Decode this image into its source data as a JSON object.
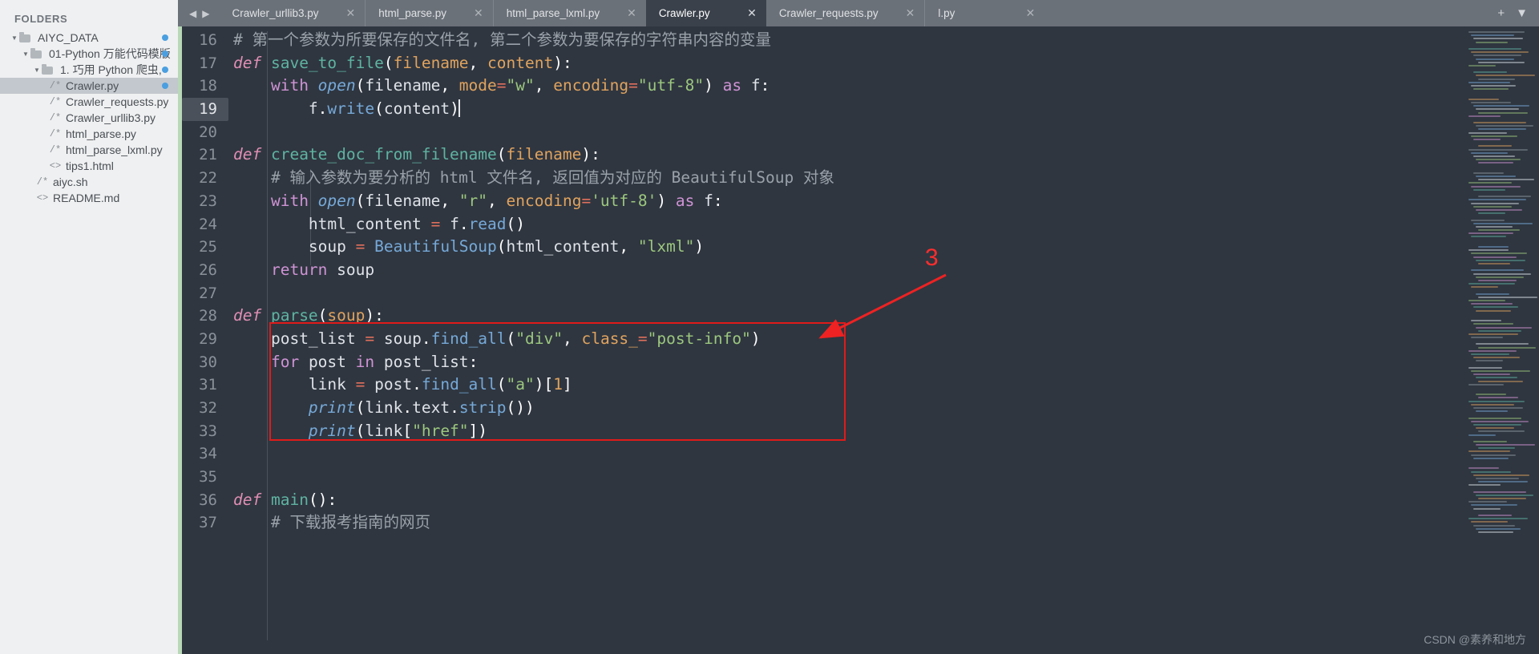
{
  "sidebar": {
    "title": "FOLDERS",
    "items": [
      {
        "label": "AIYC_DATA",
        "kind": "folder",
        "depth": 0,
        "expanded": true,
        "dot": true,
        "selected": false,
        "icon": "folder-icon"
      },
      {
        "label": "01-Python 万能代码模版",
        "kind": "folder",
        "depth": 1,
        "expanded": true,
        "dot": true,
        "selected": false,
        "icon": "folder-icon"
      },
      {
        "label": "1. 巧用 Python 爬虫,",
        "kind": "folder",
        "depth": 2,
        "expanded": true,
        "dot": true,
        "selected": false,
        "icon": "folder-icon"
      },
      {
        "label": "Crawler.py",
        "kind": "py",
        "depth": 3,
        "expanded": false,
        "dot": true,
        "selected": true,
        "icon": "python-file-icon"
      },
      {
        "label": "Crawler_requests.py",
        "kind": "py",
        "depth": 3,
        "expanded": false,
        "dot": false,
        "selected": false,
        "icon": "python-file-icon"
      },
      {
        "label": "Crawler_urllib3.py",
        "kind": "py",
        "depth": 3,
        "expanded": false,
        "dot": false,
        "selected": false,
        "icon": "python-file-icon"
      },
      {
        "label": "html_parse.py",
        "kind": "py",
        "depth": 3,
        "expanded": false,
        "dot": false,
        "selected": false,
        "icon": "python-file-icon"
      },
      {
        "label": "html_parse_lxml.py",
        "kind": "py",
        "depth": 3,
        "expanded": false,
        "dot": false,
        "selected": false,
        "icon": "python-file-icon"
      },
      {
        "label": "tips1.html",
        "kind": "html",
        "depth": 3,
        "expanded": false,
        "dot": false,
        "selected": false,
        "icon": "html-file-icon"
      },
      {
        "label": "aiyc.sh",
        "kind": "py",
        "depth": 2,
        "expanded": false,
        "dot": false,
        "selected": false,
        "icon": "shell-file-icon"
      },
      {
        "label": "README.md",
        "kind": "html",
        "depth": 2,
        "expanded": false,
        "dot": false,
        "selected": false,
        "icon": "markdown-file-icon"
      }
    ],
    "py_glyph": "/*",
    "html_glyph": "<>",
    "arrow_glyph": "▼"
  },
  "tabbar": {
    "nav_back": "◀",
    "nav_forward": "▶",
    "close_glyph": "✕",
    "new_tab_glyph": "+",
    "dropdown_glyph": "▼",
    "tabs": [
      {
        "label": "Crawler_urllib3.py",
        "active": false
      },
      {
        "label": "html_parse.py",
        "active": false
      },
      {
        "label": "html_parse_lxml.py",
        "active": false
      },
      {
        "label": "Crawler.py",
        "active": true
      },
      {
        "label": "Crawler_requests.py",
        "active": false
      },
      {
        "label": "l.py",
        "active": false
      }
    ]
  },
  "editor": {
    "current_line": 19,
    "first_line": 16,
    "lines": [
      {
        "n": 16,
        "tokens": [
          {
            "t": "# 第一个参数为所要保存的文件名, 第二个参数为要保存的字符串内容的变量",
            "c": "cmt"
          }
        ]
      },
      {
        "n": 17,
        "tokens": [
          {
            "t": "def ",
            "c": "kw"
          },
          {
            "t": "save_to_file",
            "c": "fn"
          },
          {
            "t": "(",
            "c": "punct"
          },
          {
            "t": "filename",
            "c": "param"
          },
          {
            "t": ", ",
            "c": "punct"
          },
          {
            "t": "content",
            "c": "param"
          },
          {
            "t": ")",
            "c": "punct"
          },
          {
            "t": ":",
            "c": "punct"
          }
        ]
      },
      {
        "n": 18,
        "tokens": [
          {
            "t": "    ",
            "c": "plain"
          },
          {
            "t": "with ",
            "c": "kw2"
          },
          {
            "t": "open",
            "c": "blt"
          },
          {
            "t": "(",
            "c": "punct"
          },
          {
            "t": "filename",
            "c": "plain"
          },
          {
            "t": ", ",
            "c": "punct"
          },
          {
            "t": "mode",
            "c": "param"
          },
          {
            "t": "=",
            "c": "op"
          },
          {
            "t": "\"w\"",
            "c": "str"
          },
          {
            "t": ", ",
            "c": "punct"
          },
          {
            "t": "encoding",
            "c": "param"
          },
          {
            "t": "=",
            "c": "op"
          },
          {
            "t": "\"utf-8\"",
            "c": "str"
          },
          {
            "t": ")",
            "c": "punct"
          },
          {
            "t": " as ",
            "c": "kw2"
          },
          {
            "t": "f",
            "c": "plain"
          },
          {
            "t": ":",
            "c": "punct"
          }
        ]
      },
      {
        "n": 19,
        "tokens": [
          {
            "t": "        ",
            "c": "plain"
          },
          {
            "t": "f",
            "c": "plain"
          },
          {
            "t": ".",
            "c": "punct"
          },
          {
            "t": "write",
            "c": "fn2"
          },
          {
            "t": "(",
            "c": "punct"
          },
          {
            "t": "content",
            "c": "plain"
          },
          {
            "t": ")",
            "c": "punct"
          }
        ]
      },
      {
        "n": 20,
        "tokens": []
      },
      {
        "n": 21,
        "tokens": [
          {
            "t": "def ",
            "c": "kw"
          },
          {
            "t": "create_doc_from_filename",
            "c": "fn"
          },
          {
            "t": "(",
            "c": "punct"
          },
          {
            "t": "filename",
            "c": "param"
          },
          {
            "t": ")",
            "c": "punct"
          },
          {
            "t": ":",
            "c": "punct"
          }
        ]
      },
      {
        "n": 22,
        "tokens": [
          {
            "t": "    ",
            "c": "plain"
          },
          {
            "t": "# 输入参数为要分析的 html 文件名, 返回值为对应的 BeautifulSoup 对象",
            "c": "cmt"
          }
        ]
      },
      {
        "n": 23,
        "tokens": [
          {
            "t": "    ",
            "c": "plain"
          },
          {
            "t": "with ",
            "c": "kw2"
          },
          {
            "t": "open",
            "c": "blt"
          },
          {
            "t": "(",
            "c": "punct"
          },
          {
            "t": "filename",
            "c": "plain"
          },
          {
            "t": ", ",
            "c": "punct"
          },
          {
            "t": "\"r\"",
            "c": "str"
          },
          {
            "t": ", ",
            "c": "punct"
          },
          {
            "t": "encoding",
            "c": "param"
          },
          {
            "t": "=",
            "c": "op"
          },
          {
            "t": "'utf-8'",
            "c": "str"
          },
          {
            "t": ")",
            "c": "punct"
          },
          {
            "t": " as ",
            "c": "kw2"
          },
          {
            "t": "f",
            "c": "plain"
          },
          {
            "t": ":",
            "c": "punct"
          }
        ]
      },
      {
        "n": 24,
        "tokens": [
          {
            "t": "        ",
            "c": "plain"
          },
          {
            "t": "html_content",
            "c": "plain"
          },
          {
            "t": " ",
            "c": "plain"
          },
          {
            "t": "=",
            "c": "op"
          },
          {
            "t": " ",
            "c": "plain"
          },
          {
            "t": "f",
            "c": "plain"
          },
          {
            "t": ".",
            "c": "punct"
          },
          {
            "t": "read",
            "c": "fn2"
          },
          {
            "t": "()",
            "c": "punct"
          }
        ]
      },
      {
        "n": 25,
        "tokens": [
          {
            "t": "        ",
            "c": "plain"
          },
          {
            "t": "soup",
            "c": "plain"
          },
          {
            "t": " ",
            "c": "plain"
          },
          {
            "t": "=",
            "c": "op"
          },
          {
            "t": " ",
            "c": "plain"
          },
          {
            "t": "BeautifulSoup",
            "c": "fn2"
          },
          {
            "t": "(",
            "c": "punct"
          },
          {
            "t": "html_content",
            "c": "plain"
          },
          {
            "t": ", ",
            "c": "punct"
          },
          {
            "t": "\"lxml\"",
            "c": "str"
          },
          {
            "t": ")",
            "c": "punct"
          }
        ]
      },
      {
        "n": 26,
        "tokens": [
          {
            "t": "    ",
            "c": "plain"
          },
          {
            "t": "return ",
            "c": "kw2"
          },
          {
            "t": "soup",
            "c": "plain"
          }
        ]
      },
      {
        "n": 27,
        "tokens": []
      },
      {
        "n": 28,
        "tokens": [
          {
            "t": "def ",
            "c": "kw"
          },
          {
            "t": "parse",
            "c": "fn"
          },
          {
            "t": "(",
            "c": "punct"
          },
          {
            "t": "soup",
            "c": "param"
          },
          {
            "t": ")",
            "c": "punct"
          },
          {
            "t": ":",
            "c": "punct"
          }
        ]
      },
      {
        "n": 29,
        "tokens": [
          {
            "t": "    ",
            "c": "plain"
          },
          {
            "t": "post_list",
            "c": "plain"
          },
          {
            "t": " ",
            "c": "plain"
          },
          {
            "t": "=",
            "c": "op"
          },
          {
            "t": " ",
            "c": "plain"
          },
          {
            "t": "soup",
            "c": "plain"
          },
          {
            "t": ".",
            "c": "punct"
          },
          {
            "t": "find_all",
            "c": "fn2"
          },
          {
            "t": "(",
            "c": "punct"
          },
          {
            "t": "\"div\"",
            "c": "str"
          },
          {
            "t": ", ",
            "c": "punct"
          },
          {
            "t": "class_",
            "c": "param"
          },
          {
            "t": "=",
            "c": "op"
          },
          {
            "t": "\"post-info\"",
            "c": "str"
          },
          {
            "t": ")",
            "c": "punct"
          }
        ]
      },
      {
        "n": 30,
        "tokens": [
          {
            "t": "    ",
            "c": "plain"
          },
          {
            "t": "for ",
            "c": "kw2"
          },
          {
            "t": "post",
            "c": "plain"
          },
          {
            "t": " ",
            "c": "plain"
          },
          {
            "t": "in ",
            "c": "kw2"
          },
          {
            "t": "post_list",
            "c": "plain"
          },
          {
            "t": ":",
            "c": "punct"
          }
        ]
      },
      {
        "n": 31,
        "tokens": [
          {
            "t": "        ",
            "c": "plain"
          },
          {
            "t": "link",
            "c": "plain"
          },
          {
            "t": " ",
            "c": "plain"
          },
          {
            "t": "=",
            "c": "op"
          },
          {
            "t": " ",
            "c": "plain"
          },
          {
            "t": "post",
            "c": "plain"
          },
          {
            "t": ".",
            "c": "punct"
          },
          {
            "t": "find_all",
            "c": "fn2"
          },
          {
            "t": "(",
            "c": "punct"
          },
          {
            "t": "\"a\"",
            "c": "str"
          },
          {
            "t": ")[",
            "c": "punct"
          },
          {
            "t": "1",
            "c": "num"
          },
          {
            "t": "]",
            "c": "punct"
          }
        ]
      },
      {
        "n": 32,
        "tokens": [
          {
            "t": "        ",
            "c": "plain"
          },
          {
            "t": "print",
            "c": "blt"
          },
          {
            "t": "(",
            "c": "punct"
          },
          {
            "t": "link",
            "c": "plain"
          },
          {
            "t": ".",
            "c": "punct"
          },
          {
            "t": "text",
            "c": "plain"
          },
          {
            "t": ".",
            "c": "punct"
          },
          {
            "t": "strip",
            "c": "fn2"
          },
          {
            "t": "())",
            "c": "punct"
          }
        ]
      },
      {
        "n": 33,
        "tokens": [
          {
            "t": "        ",
            "c": "plain"
          },
          {
            "t": "print",
            "c": "blt"
          },
          {
            "t": "(",
            "c": "punct"
          },
          {
            "t": "link",
            "c": "plain"
          },
          {
            "t": "[",
            "c": "punct"
          },
          {
            "t": "\"href\"",
            "c": "str"
          },
          {
            "t": "])",
            "c": "punct"
          }
        ]
      },
      {
        "n": 34,
        "tokens": []
      },
      {
        "n": 35,
        "tokens": []
      },
      {
        "n": 36,
        "tokens": [
          {
            "t": "def ",
            "c": "kw"
          },
          {
            "t": "main",
            "c": "fn"
          },
          {
            "t": "(",
            "c": "punct"
          },
          {
            "t": ")",
            "c": "punct"
          },
          {
            "t": ":",
            "c": "punct"
          }
        ]
      },
      {
        "n": 37,
        "tokens": [
          {
            "t": "    ",
            "c": "plain"
          },
          {
            "t": "# 下载报考指南的网页",
            "c": "cmt"
          }
        ]
      }
    ]
  },
  "annotation": {
    "number": "3",
    "box_color": "#e01b1b",
    "arrow_color": "#ee2222"
  },
  "watermark": {
    "text": "CSDN @素养和地方"
  },
  "colors": {
    "editor_bg": "#2f3640",
    "sidebar_bg": "#eff0f1",
    "tabbar_bg": "#6b7179",
    "active_tab_bg": "#3a414b",
    "accent_strip": "#b8d8b8",
    "dot_blue": "#4a9fe0"
  }
}
